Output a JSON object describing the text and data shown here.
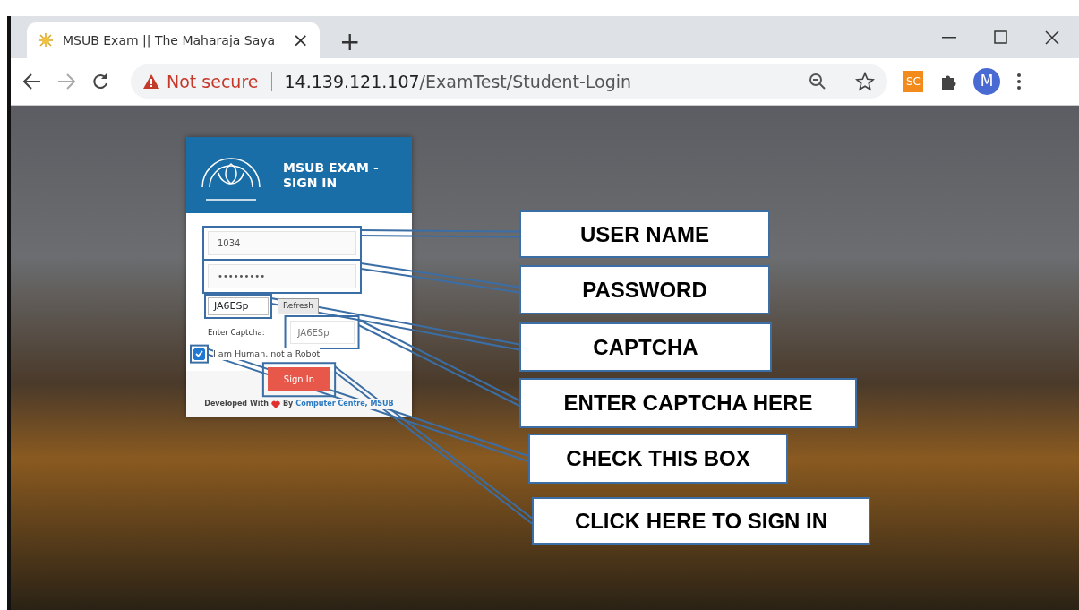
{
  "browser": {
    "tab": {
      "title": "MSUB Exam || The Maharaja Saya",
      "close": "×"
    },
    "new_tab": "+",
    "security": "Not secure",
    "url_host": "14.139.121.107",
    "url_path": "/ExamTest/Student-Login",
    "extension": "SC",
    "profile": "M"
  },
  "login": {
    "title": "MSUB EXAM - SIGN IN",
    "username": "1034",
    "password_mask": "•••••••••",
    "captcha_code": "JA6ESp",
    "refresh": "Refresh",
    "captcha_label": "Enter Captcha:",
    "captcha_input": "JA6ESp",
    "robot_check": {
      "label": "I am Human, not a Robot",
      "checked": true
    },
    "submit": "Sign In",
    "footer": {
      "prefix": "Developed With",
      "by": "By",
      "link": "Computer Centre, MSUB"
    }
  },
  "annotations": [
    {
      "label": "USER NAME"
    },
    {
      "label": "PASSWORD"
    },
    {
      "label": "CAPTCHA"
    },
    {
      "label": "ENTER CAPTCHA HERE"
    },
    {
      "label": "CHECK THIS BOX"
    },
    {
      "label": "CLICK HERE TO SIGN IN"
    }
  ]
}
